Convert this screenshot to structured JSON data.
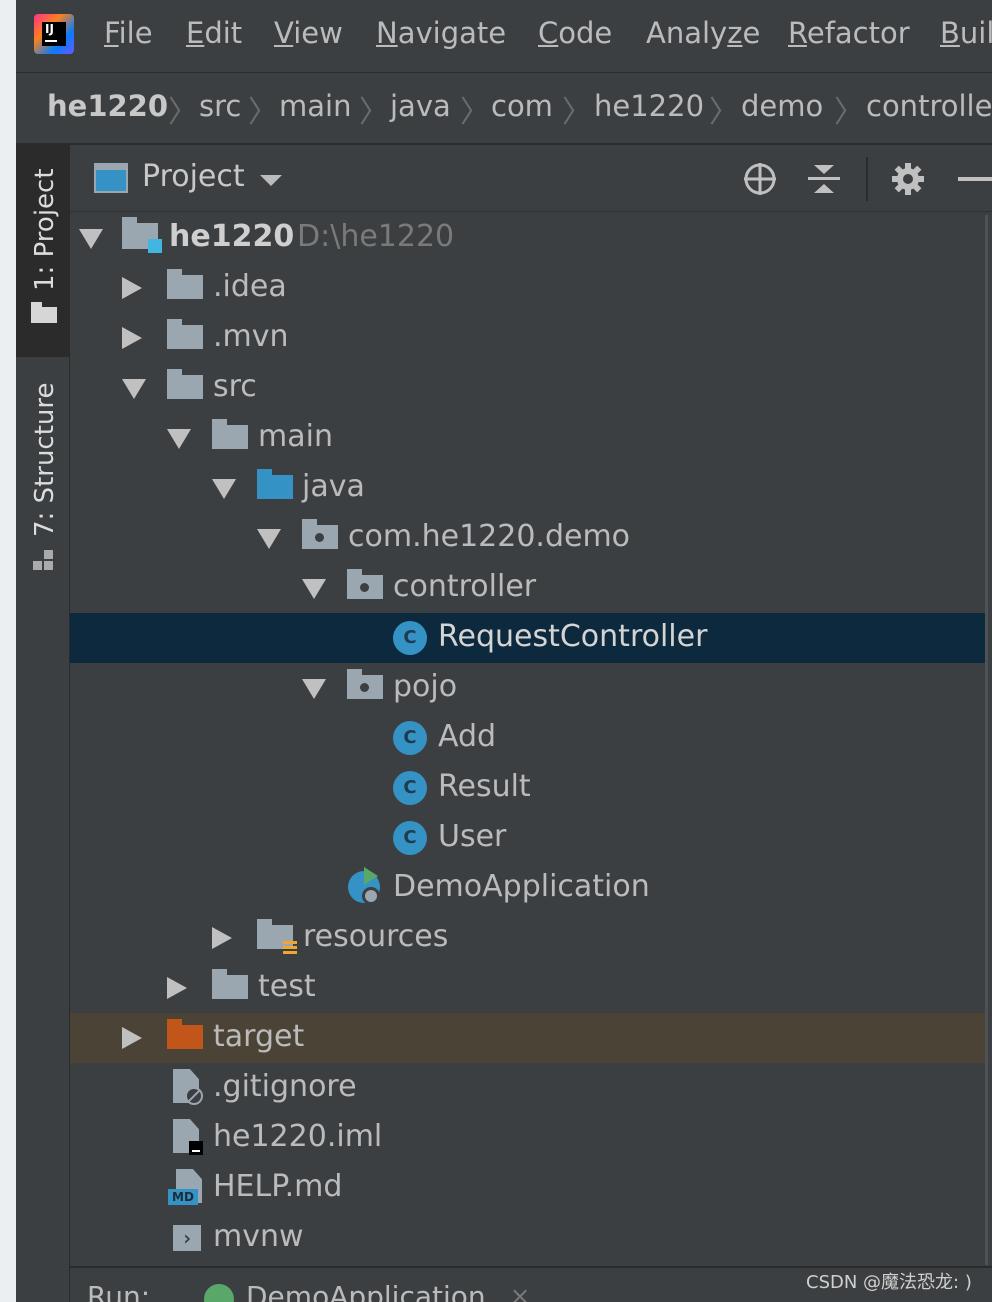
{
  "menu": {
    "items": [
      {
        "mnemonic": "F",
        "rest": "ile"
      },
      {
        "mnemonic": "E",
        "rest": "dit"
      },
      {
        "mnemonic": "V",
        "rest": "iew"
      },
      {
        "mnemonic": "N",
        "rest": "avigate"
      },
      {
        "mnemonic": "C",
        "rest": "ode"
      },
      {
        "pre": "Analy",
        "mnemonic": "z",
        "rest": "e"
      },
      {
        "mnemonic": "R",
        "rest": "efactor"
      },
      {
        "mnemonic": "B",
        "rest": "uil"
      }
    ]
  },
  "logo_text": "IJ",
  "breadcrumb": [
    "he1220",
    "src",
    "main",
    "java",
    "com",
    "he1220",
    "demo",
    "controlle"
  ],
  "toolstrip": {
    "project_tab": "1: Project",
    "structure_tab": "7: Structure"
  },
  "panel": {
    "title": "Project",
    "buttons": [
      "locate-icon",
      "collapse-all-icon",
      "gear-icon",
      "minimize-icon"
    ]
  },
  "tree": {
    "root_name": "he1220",
    "root_path": "D:\\he1220",
    "idea": ".idea",
    "mvn": ".mvn",
    "src": "src",
    "main": "main",
    "java": "java",
    "package": "com.he1220.demo",
    "controller": "controller",
    "request_controller": "RequestController",
    "class_badge": "C",
    "pojo": "pojo",
    "add": "Add",
    "result": "Result",
    "user": "User",
    "demo_application": "DemoApplication",
    "resources": "resources",
    "test": "test",
    "target": "target",
    "gitignore": ".gitignore",
    "iml": "he1220.iml",
    "help": "HELP.md",
    "md_badge": "MD",
    "mvnw": "mvnw"
  },
  "runbar": {
    "label": "Run:",
    "app": "DemoApplication",
    "close": "×"
  },
  "watermark": "CSDN @魔法恐龙: )",
  "colors": {
    "background": "#3c3f41",
    "selection": "#0d293e",
    "excluded": "#4b4336",
    "java_class": "#3592c4",
    "excluded_folder": "#c2561a"
  }
}
